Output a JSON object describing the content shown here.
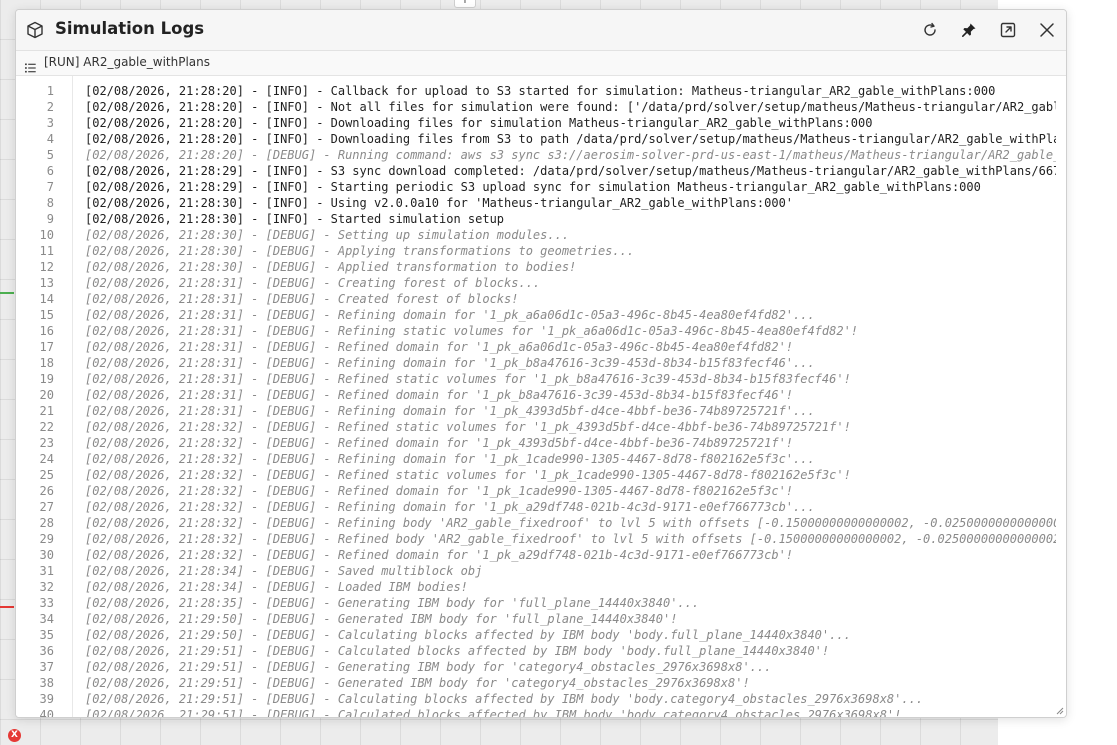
{
  "dialog": {
    "title": "Simulation Logs",
    "run_label": "[RUN] AR2_gable_withPlans",
    "icons": {
      "title": "cube-icon",
      "refresh": "refresh-icon",
      "pin": "pin-icon",
      "popout": "open-external-icon",
      "close": "close-icon",
      "list": "list-icon"
    }
  },
  "viewport": {
    "handle_label": "+",
    "x_badge": "X"
  },
  "colors": {
    "info_text": "#1f1f1f",
    "debug_text": "#8a8a8a",
    "line_number": "#8a8a8a"
  },
  "log": {
    "lines": [
      {
        "n": "1",
        "level": "info",
        "text": "[02/08/2026, 21:28:20] - [INFO] - Callback for upload to S3 started for simulation: Matheus-triangular_AR2_gable_withPlans:000"
      },
      {
        "n": "2",
        "level": "info",
        "text": "[02/08/2026, 21:28:20] - [INFO] - Not all files for simulation were found: ['/data/prd/solver/setup/matheus/Matheus-triangular/AR2_gabl"
      },
      {
        "n": "3",
        "level": "info",
        "text": "[02/08/2026, 21:28:20] - [INFO] - Downloading files for simulation Matheus-triangular_AR2_gable_withPlans:000"
      },
      {
        "n": "4",
        "level": "info",
        "text": "[02/08/2026, 21:28:20] - [INFO] - Downloading files from S3 to path /data/prd/solver/setup/matheus/Matheus-triangular/AR2_gable_withPla"
      },
      {
        "n": "5",
        "level": "debug",
        "text": "[02/08/2026, 21:28:20] - [DEBUG] - Running command: aws s3 sync s3://aerosim-solver-prd-us-east-1/matheus/Matheus-triangular/AR2_gable_"
      },
      {
        "n": "6",
        "level": "info",
        "text": "[02/08/2026, 21:28:29] - [INFO] - S3 sync download completed: /data/prd/solver/setup/matheus/Matheus-triangular/AR2_gable_withPlans/667"
      },
      {
        "n": "7",
        "level": "info",
        "text": "[02/08/2026, 21:28:29] - [INFO] - Starting periodic S3 upload sync for simulation Matheus-triangular_AR2_gable_withPlans:000"
      },
      {
        "n": "8",
        "level": "info",
        "text": "[02/08/2026, 21:28:30] - [INFO] - Using v2.0.0a10 for 'Matheus-triangular_AR2_gable_withPlans:000'"
      },
      {
        "n": "9",
        "level": "info",
        "text": "[02/08/2026, 21:28:30] - [INFO] - Started simulation setup"
      },
      {
        "n": "10",
        "level": "debug",
        "text": "[02/08/2026, 21:28:30] - [DEBUG] - Setting up simulation modules..."
      },
      {
        "n": "11",
        "level": "debug",
        "text": "[02/08/2026, 21:28:30] - [DEBUG] - Applying transformations to geometries..."
      },
      {
        "n": "12",
        "level": "debug",
        "text": "[02/08/2026, 21:28:30] - [DEBUG] - Applied transformation to bodies!"
      },
      {
        "n": "13",
        "level": "debug",
        "text": "[02/08/2026, 21:28:31] - [DEBUG] - Creating forest of blocks..."
      },
      {
        "n": "14",
        "level": "debug",
        "text": "[02/08/2026, 21:28:31] - [DEBUG] - Created forest of blocks!"
      },
      {
        "n": "15",
        "level": "debug",
        "text": "[02/08/2026, 21:28:31] - [DEBUG] - Refining domain for '1_pk_a6a06d1c-05a3-496c-8b45-4ea80ef4fd82'..."
      },
      {
        "n": "16",
        "level": "debug",
        "text": "[02/08/2026, 21:28:31] - [DEBUG] - Refining static volumes for '1_pk_a6a06d1c-05a3-496c-8b45-4ea80ef4fd82'!"
      },
      {
        "n": "17",
        "level": "debug",
        "text": "[02/08/2026, 21:28:31] - [DEBUG] - Refined domain for '1_pk_a6a06d1c-05a3-496c-8b45-4ea80ef4fd82'!"
      },
      {
        "n": "18",
        "level": "debug",
        "text": "[02/08/2026, 21:28:31] - [DEBUG] - Refining domain for '1_pk_b8a47616-3c39-453d-8b34-b15f83fecf46'..."
      },
      {
        "n": "19",
        "level": "debug",
        "text": "[02/08/2026, 21:28:31] - [DEBUG] - Refined static volumes for '1_pk_b8a47616-3c39-453d-8b34-b15f83fecf46'!"
      },
      {
        "n": "20",
        "level": "debug",
        "text": "[02/08/2026, 21:28:31] - [DEBUG] - Refined domain for '1_pk_b8a47616-3c39-453d-8b34-b15f83fecf46'!"
      },
      {
        "n": "21",
        "level": "debug",
        "text": "[02/08/2026, 21:28:31] - [DEBUG] - Refining domain for '1_pk_4393d5bf-d4ce-4bbf-be36-74b89725721f'..."
      },
      {
        "n": "22",
        "level": "debug",
        "text": "[02/08/2026, 21:28:32] - [DEBUG] - Refined static volumes for '1_pk_4393d5bf-d4ce-4bbf-be36-74b89725721f'!"
      },
      {
        "n": "23",
        "level": "debug",
        "text": "[02/08/2026, 21:28:32] - [DEBUG] - Refined domain for '1_pk_4393d5bf-d4ce-4bbf-be36-74b89725721f'!"
      },
      {
        "n": "24",
        "level": "debug",
        "text": "[02/08/2026, 21:28:32] - [DEBUG] - Refining domain for '1_pk_1cade990-1305-4467-8d78-f802162e5f3c'..."
      },
      {
        "n": "25",
        "level": "debug",
        "text": "[02/08/2026, 21:28:32] - [DEBUG] - Refined static volumes for '1_pk_1cade990-1305-4467-8d78-f802162e5f3c'!"
      },
      {
        "n": "26",
        "level": "debug",
        "text": "[02/08/2026, 21:28:32] - [DEBUG] - Refined domain for '1_pk_1cade990-1305-4467-8d78-f802162e5f3c'!"
      },
      {
        "n": "27",
        "level": "debug",
        "text": "[02/08/2026, 21:28:32] - [DEBUG] - Refining domain for '1_pk_a29df748-021b-4c3d-9171-e0ef766773cb'..."
      },
      {
        "n": "28",
        "level": "debug",
        "text": "[02/08/2026, 21:28:32] - [DEBUG] - Refining body 'AR2_gable_fixedroof' to lvl 5 with offsets [-0.15000000000000002, -0.0250000000000000"
      },
      {
        "n": "29",
        "level": "debug",
        "text": "[02/08/2026, 21:28:32] - [DEBUG] - Refined body 'AR2_gable_fixedroof' to lvl 5 with offsets [-0.15000000000000002, -0.02500000000000002"
      },
      {
        "n": "30",
        "level": "debug",
        "text": "[02/08/2026, 21:28:32] - [DEBUG] - Refined domain for '1_pk_a29df748-021b-4c3d-9171-e0ef766773cb'!"
      },
      {
        "n": "31",
        "level": "debug",
        "text": "[02/08/2026, 21:28:34] - [DEBUG] - Saved multiblock obj"
      },
      {
        "n": "32",
        "level": "debug",
        "text": "[02/08/2026, 21:28:34] - [DEBUG] - Loaded IBM bodies!"
      },
      {
        "n": "33",
        "level": "debug",
        "text": "[02/08/2026, 21:28:35] - [DEBUG] - Generating IBM body for 'full_plane_14440x3840'..."
      },
      {
        "n": "34",
        "level": "debug",
        "text": "[02/08/2026, 21:29:50] - [DEBUG] - Generated IBM body for 'full_plane_14440x3840'!"
      },
      {
        "n": "35",
        "level": "debug",
        "text": "[02/08/2026, 21:29:50] - [DEBUG] - Calculating blocks affected by IBM body 'body.full_plane_14440x3840'..."
      },
      {
        "n": "36",
        "level": "debug",
        "text": "[02/08/2026, 21:29:51] - [DEBUG] - Calculated blocks affected by IBM body 'body.full_plane_14440x3840'!"
      },
      {
        "n": "37",
        "level": "debug",
        "text": "[02/08/2026, 21:29:51] - [DEBUG] - Generating IBM body for 'category4_obstacles_2976x3698x8'..."
      },
      {
        "n": "38",
        "level": "debug",
        "text": "[02/08/2026, 21:29:51] - [DEBUG] - Generated IBM body for 'category4_obstacles_2976x3698x8'!"
      },
      {
        "n": "39",
        "level": "debug",
        "text": "[02/08/2026, 21:29:51] - [DEBUG] - Calculating blocks affected by IBM body 'body.category4_obstacles_2976x3698x8'..."
      },
      {
        "n": "40",
        "level": "debug",
        "text": "[02/08/2026, 21:29:51] - [DEBUG] - Calculated blocks affected by IBM body 'body.category4_obstacles_2976x3698x8'!"
      }
    ]
  }
}
